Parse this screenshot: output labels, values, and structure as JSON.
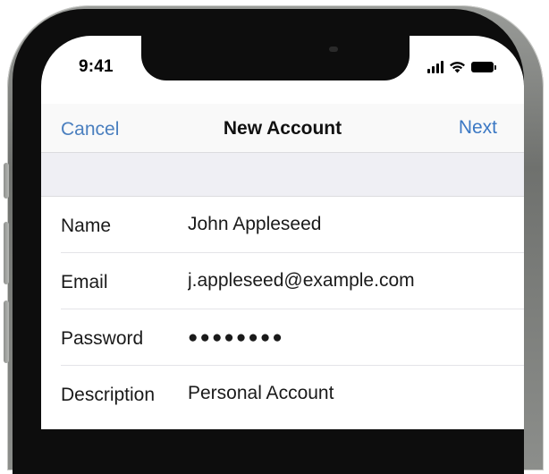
{
  "status_bar": {
    "time": "9:41",
    "icons": [
      "signal-icon",
      "wifi-icon",
      "battery-icon"
    ]
  },
  "nav": {
    "cancel_label": "Cancel",
    "title": "New Account",
    "next_label": "Next"
  },
  "form": {
    "rows": [
      {
        "label": "Name",
        "value": "John Appleseed"
      },
      {
        "label": "Email",
        "value": "j.appleseed@example.com"
      },
      {
        "label": "Password",
        "value": "●●●●●●●●"
      },
      {
        "label": "Description",
        "value": "Personal Account"
      }
    ]
  },
  "colors": {
    "accent": "#3b78c4",
    "nav_background": "#f9f9f9",
    "group_background": "#efeff4",
    "bezel": "#0d0d0d"
  }
}
